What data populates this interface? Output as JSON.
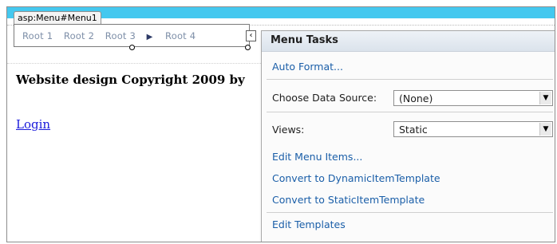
{
  "control_tag": "asp:Menu#Menu1",
  "menu": {
    "items": [
      "Root 1",
      "Root 2",
      "Root 3",
      "Root 4"
    ],
    "arrow_icon": "triangle-right-icon"
  },
  "collapse_icon": "chevron-left-icon",
  "page": {
    "copyright": "Website design Copyright 2009 by",
    "login": "Login"
  },
  "tasks": {
    "title": "Menu Tasks",
    "auto_format": "Auto Format...",
    "data_source_label": "Choose Data Source:",
    "data_source_value": "(None)",
    "views_label": "Views:",
    "views_value": "Static",
    "edit_menu_items": "Edit Menu Items...",
    "convert_dynamic": "Convert to DynamicItemTemplate",
    "convert_static": "Convert to StaticItemTemplate",
    "edit_templates": "Edit Templates"
  }
}
